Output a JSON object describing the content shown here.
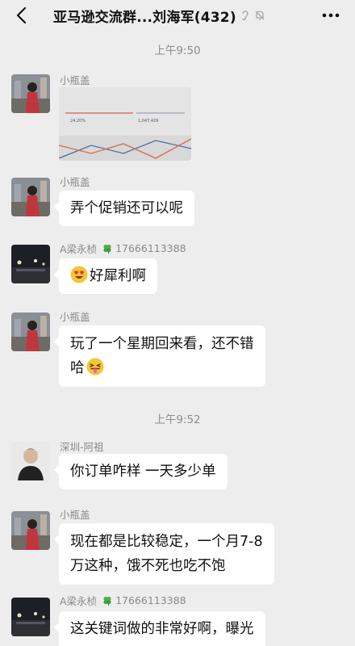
{
  "header": {
    "title": "亚马逊交流群...刘海军(432)"
  },
  "messages": [
    {
      "time": "上午9:50"
    },
    {
      "sender": "小瓶盖",
      "image_label_a": "24.20%",
      "image_label_b": "1,047,429"
    },
    {
      "sender": "小瓶盖",
      "text": "弄个促销还可以呢"
    },
    {
      "sender": "A梁永桢",
      "phone": "17666113388",
      "text": "好犀利啊",
      "emoji": "heart-eyes"
    },
    {
      "sender": "小瓶盖",
      "line1": "玩了一个星期回来看，还不错",
      "line2": "哈",
      "emoji": "tongue"
    },
    {
      "time": "上午9:52"
    },
    {
      "sender": "深圳-阿祖",
      "text": "你订单咋样 一天多少单"
    },
    {
      "sender": "小瓶盖",
      "line1": "现在都是比较稳定，一个月7-8",
      "line2": "万这种，饿不死也吃不饱"
    },
    {
      "sender": "A梁永桢",
      "phone": "17666113388",
      "text": "这关键词做的非常好啊，曝光"
    }
  ],
  "colors": {
    "background": "#ededed",
    "bubble": "#ffffff",
    "meta_text": "#8a8a8a"
  }
}
